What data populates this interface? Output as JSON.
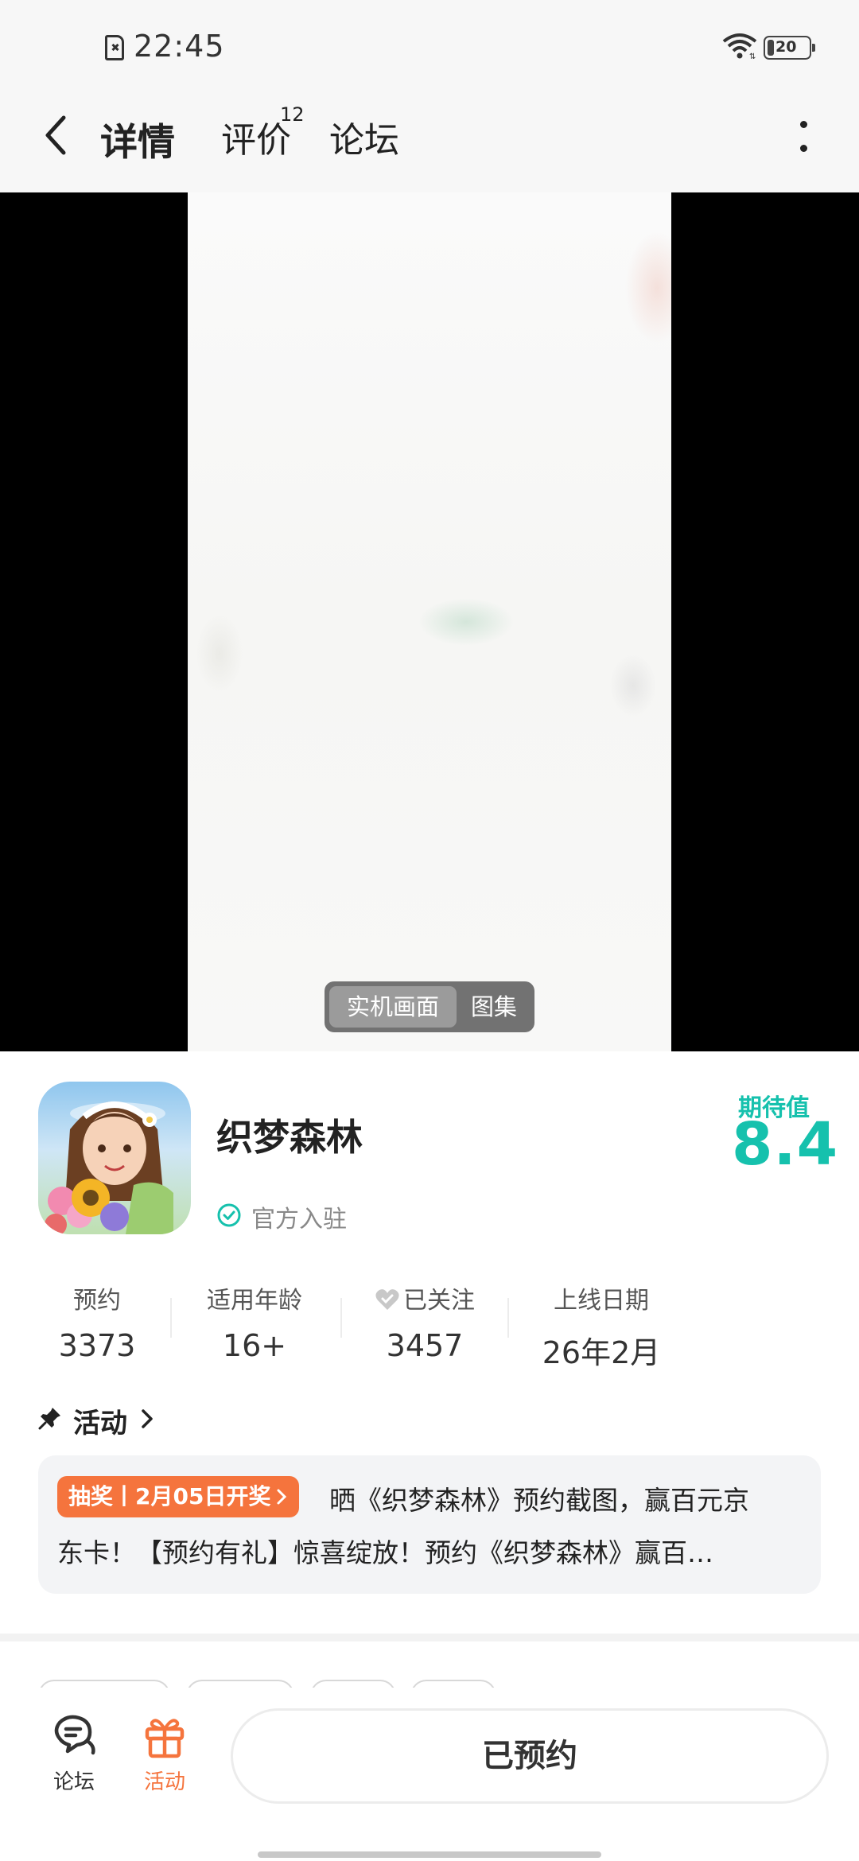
{
  "status_bar": {
    "time": "22:45",
    "battery": "20"
  },
  "nav": {
    "tabs": [
      {
        "label": "详情"
      },
      {
        "label": "评价",
        "badge": "12"
      },
      {
        "label": "论坛"
      }
    ]
  },
  "media": {
    "toggle_options": [
      "实机画面",
      "图集"
    ]
  },
  "app": {
    "name": "织梦森林",
    "official": "官方入驻",
    "expect_label": "期待值",
    "expect_score": "8.4"
  },
  "stats": [
    {
      "label": "预约",
      "value": "3373"
    },
    {
      "label": "适用年龄",
      "value": "16+"
    },
    {
      "label": "已关注",
      "value": "3457"
    },
    {
      "label": "上线日期",
      "value": "26年2月"
    }
  ],
  "activity": {
    "title": "活动",
    "tag": "抽奖丨2月05日开奖",
    "line1": "晒《织梦森林》预约截图，赢百元京",
    "line2": "东卡！【预约有礼】惊喜绽放！预约《织梦森林》赢百…"
  },
  "bottom_bar": {
    "forum_label": "论坛",
    "activity_label": "活动",
    "reserve_label": "已预约"
  },
  "colors": {
    "accent": "#16c1ad",
    "activity": "#f5743d"
  }
}
